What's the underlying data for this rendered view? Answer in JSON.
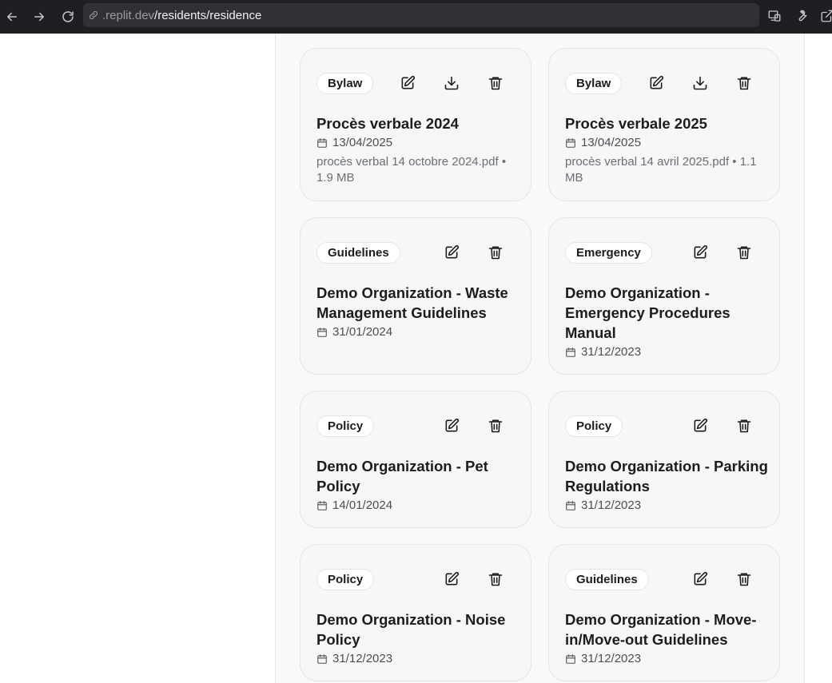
{
  "browser": {
    "url_domain": ".replit.dev",
    "url_path": "/residents/residence"
  },
  "documents": [
    {
      "category": "Bylaw",
      "title": "Procès verbale 2024",
      "date": "13/04/2025",
      "file": "procès verbal 14 octobre 2024.pdf • 1.9 MB",
      "download": true
    },
    {
      "category": "Bylaw",
      "title": "Procès verbale 2025",
      "date": "13/04/2025",
      "file": "procès verbal 14 avril 2025.pdf • 1.1 MB",
      "download": true
    },
    {
      "category": "Guidelines",
      "title": "Demo Organization - Waste Management Guidelines",
      "date": "31/01/2024"
    },
    {
      "category": "Emergency",
      "title": "Demo Organization - Emergency Procedures Manual",
      "date": "31/12/2023"
    },
    {
      "category": "Policy",
      "title": "Demo Organization - Pet Policy",
      "date": "14/01/2024"
    },
    {
      "category": "Policy",
      "title": "Demo Organization - Parking Regulations",
      "date": "31/12/2023"
    },
    {
      "category": "Policy",
      "title": "Demo Organization - Noise Policy",
      "date": "31/12/2023"
    },
    {
      "category": "Guidelines",
      "title": "Demo Organization - Move-in/Move-out Guidelines",
      "date": "31/12/2023"
    }
  ]
}
